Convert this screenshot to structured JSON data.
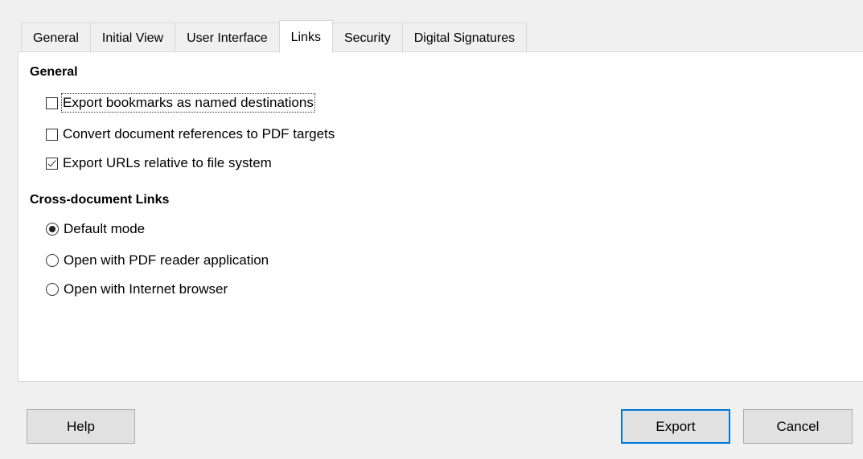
{
  "tabs": [
    {
      "label": "General"
    },
    {
      "label": "Initial View"
    },
    {
      "label": "User Interface"
    },
    {
      "label": "Links",
      "active": true
    },
    {
      "label": "Security"
    },
    {
      "label": "Digital Signatures"
    }
  ],
  "general": {
    "title": "General",
    "options": [
      {
        "label": "Export bookmarks as named destinations",
        "checked": false
      },
      {
        "label": "Convert document references to PDF targets",
        "checked": false
      },
      {
        "label": "Export URLs relative to file system",
        "checked": true
      }
    ]
  },
  "cross_document": {
    "title": "Cross-document Links",
    "options": [
      {
        "label": "Default mode",
        "selected": true
      },
      {
        "label": "Open with PDF reader application",
        "selected": false
      },
      {
        "label": "Open with Internet browser",
        "selected": false
      }
    ]
  },
  "buttons": {
    "help": "Help",
    "export": "Export",
    "cancel": "Cancel"
  },
  "colors": {
    "focus_border": "#0078d7"
  }
}
